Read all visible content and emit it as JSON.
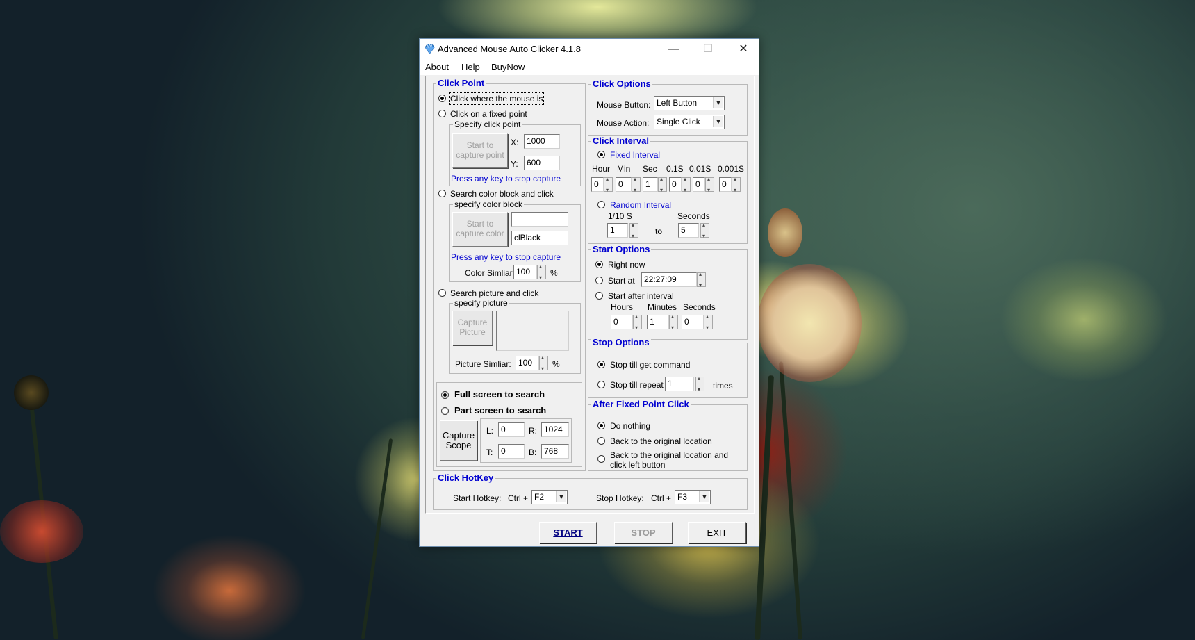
{
  "window": {
    "title": "Advanced Mouse Auto Clicker 4.1.8",
    "minimize_glyph": "—",
    "maximize_glyph": "☐",
    "close_glyph": "✕"
  },
  "menu": {
    "about": "About",
    "help": "Help",
    "buy": "BuyNow"
  },
  "click_point": {
    "title": "Click Point",
    "mouse_is": "Click where the mouse is",
    "fixed_point": "Click on a fixed point",
    "specify_point": "Specify click point",
    "capture_point_btn": "Start to capture point",
    "x_label": "X:",
    "x_value": "1000",
    "y_label": "Y:",
    "y_value": "600",
    "press_any_key_1": "Press any key to stop capture",
    "search_color": "Search color block and click",
    "specify_color": "specify color block",
    "capture_color_btn": "Start to capture color",
    "color_value": "",
    "color_name": "clBlack",
    "press_any_key_2": "Press any key to stop capture",
    "color_similar_label": "Color Simliar:",
    "color_similar_value": "100",
    "percent_1": "%",
    "search_picture": "Search picture and click",
    "specify_picture": "specify picture",
    "capture_picture_btn": "Capture Picture",
    "picture_similar_label": "Picture Simliar:",
    "picture_similar_value": "100",
    "percent_2": "%",
    "full_screen": "Full screen to search",
    "part_screen": "Part screen to search",
    "capture_scope_btn": "Capture Scope",
    "l_label": "L:",
    "l_value": "0",
    "r_label": "R:",
    "r_value": "1024",
    "t_label": "T:",
    "t_value": "0",
    "b_label": "B:",
    "b_value": "768"
  },
  "click_options": {
    "title": "Click Options",
    "mouse_button_label": "Mouse Button:",
    "mouse_button_value": "Left Button",
    "mouse_action_label": "Mouse Action:",
    "mouse_action_value": "Single Click"
  },
  "click_interval": {
    "title": "Click Interval",
    "fixed": "Fixed Interval",
    "headers": [
      "Hour",
      "Min",
      "Sec",
      "0.1S",
      "0.01S",
      "0.001S"
    ],
    "values": [
      "0",
      "0",
      "1",
      "0",
      "0",
      "0"
    ],
    "random": "Random Interval",
    "tenth_label": "1/10 S",
    "seconds_label": "Seconds",
    "random_from": "1",
    "to_label": "to",
    "random_to": "5"
  },
  "start_options": {
    "title": "Start Options",
    "right_now": "Right now",
    "start_at": "Start at",
    "start_at_value": "22:27:09",
    "after_interval": "Start after interval",
    "hours_label": "Hours",
    "minutes_label": "Minutes",
    "seconds_label": "Seconds",
    "hours_value": "0",
    "minutes_value": "1",
    "seconds_value": "0"
  },
  "stop_options": {
    "title": "Stop Options",
    "till_command": "Stop till get command",
    "till_repeat": "Stop till repeat",
    "repeat_value": "1",
    "times_label": "times"
  },
  "after_click": {
    "title": "After Fixed Point Click",
    "do_nothing": "Do nothing",
    "back_original": "Back to the original location",
    "back_click_line1": "Back to the original location and",
    "back_click_line2": "click left button"
  },
  "hotkey": {
    "title": "Click HotKey",
    "start_label": "Start Hotkey:",
    "start_ctrl": "Ctrl +",
    "start_key": "F2",
    "stop_label": "Stop Hotkey:",
    "stop_ctrl": "Ctrl +",
    "stop_key": "F3"
  },
  "buttons": {
    "start": "START",
    "stop": "STOP",
    "exit": "EXIT"
  },
  "icons": {
    "dropdown": "▼"
  }
}
